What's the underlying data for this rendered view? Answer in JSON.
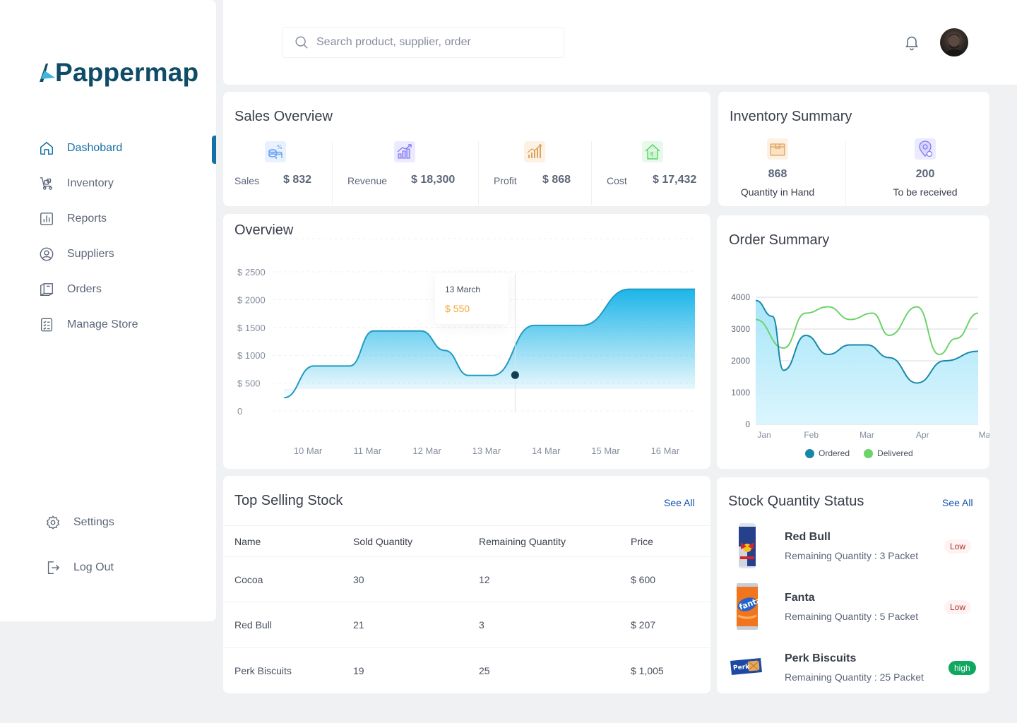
{
  "app": {
    "name": "Pappermap",
    "brand_color": "#0F4C68",
    "accent": "#1570A6"
  },
  "sidebar": {
    "items": [
      {
        "label": "Dashobard",
        "icon": "home-icon",
        "active": true
      },
      {
        "label": "Inventory",
        "icon": "inventory-icon"
      },
      {
        "label": "Reports",
        "icon": "reports-icon"
      },
      {
        "label": "Suppliers",
        "icon": "suppliers-icon"
      },
      {
        "label": "Orders",
        "icon": "orders-icon"
      },
      {
        "label": "Manage Store",
        "icon": "manage-store-icon"
      }
    ],
    "footer": [
      {
        "label": "Settings",
        "icon": "gear-icon"
      },
      {
        "label": "Log Out",
        "icon": "logout-icon"
      }
    ]
  },
  "topbar": {
    "search_placeholder": "Search product, supplier, order"
  },
  "sales_overview": {
    "title": "Sales Overview",
    "stats": [
      {
        "label": "Sales",
        "value": "$ 832",
        "icon": "sales-icon",
        "color": "#6FA4FF"
      },
      {
        "label": "Revenue",
        "value": "$ 18,300",
        "icon": "revenue-icon",
        "color": "#817AF3"
      },
      {
        "label": "Profit",
        "value": "$ 868",
        "icon": "profit-icon",
        "color": "#DBA362"
      },
      {
        "label": "Cost",
        "value": "$ 17,432",
        "icon": "cost-icon",
        "color": "#58D365"
      }
    ]
  },
  "inventory_summary": {
    "title": "Inventory Summary",
    "stats": [
      {
        "value": "868",
        "label": "Quantity in Hand",
        "icon": "box-icon"
      },
      {
        "value": "200",
        "label": "To be received",
        "icon": "location-icon"
      }
    ]
  },
  "overview": {
    "title": "Overview",
    "tooltip": {
      "date": "13 March",
      "value": "$ 550"
    }
  },
  "order_summary": {
    "title": "Order Summary",
    "legend": [
      "Ordered",
      "Delivered"
    ]
  },
  "chart_data": [
    {
      "type": "area",
      "title": "Overview",
      "x": [
        "10 Mar",
        "11 Mar",
        "12 Mar",
        "13 Mar",
        "14 Mar",
        "15 Mar",
        "16 Mar"
      ],
      "y_ticks": [
        "0",
        "$ 500",
        "$ 1000",
        "$ 1500",
        "$ 2000",
        "$ 2500"
      ],
      "ylim": [
        0,
        2500
      ],
      "series": [
        {
          "values": [
            250,
            820,
            820,
            1450,
            1450,
            1100,
            650,
            650,
            1550,
            1550,
            2200,
            2200
          ],
          "x_positions": [
            9.6,
            10.1,
            10.7,
            11.1,
            11.9,
            12.3,
            12.7,
            13.1,
            13.8,
            14.6,
            15.4,
            16.5
          ]
        }
      ],
      "highlight": {
        "x": "13 Mar",
        "value": 650
      },
      "color": "#1F9BC2"
    },
    {
      "type": "line",
      "title": "Order Summary",
      "categories": [
        "Jan",
        "Feb",
        "Mar",
        "Apr",
        "May"
      ],
      "y_ticks": [
        "0",
        "1000",
        "2000",
        "3000",
        "4000"
      ],
      "ylim": [
        0,
        4000
      ],
      "series": [
        {
          "name": "Ordered",
          "color": "#1888AA",
          "x": [
            0,
            0.3,
            0.5,
            0.9,
            1.3,
            1.7,
            2.0,
            2.4,
            2.9,
            3.4,
            4.0
          ],
          "values": [
            3900,
            3400,
            1700,
            2800,
            2200,
            2500,
            2500,
            2100,
            1300,
            2000,
            2300
          ]
        },
        {
          "name": "Delivered",
          "color": "#6CD36A",
          "x": [
            0,
            0.5,
            0.9,
            1.3,
            1.7,
            2.1,
            2.4,
            2.9,
            3.3,
            3.6,
            4.0
          ],
          "values": [
            3300,
            2400,
            3500,
            3700,
            3300,
            3500,
            2800,
            3700,
            2200,
            2700,
            3500
          ]
        }
      ]
    }
  ],
  "top_selling_stock": {
    "title": "Top Selling Stock",
    "see_all": "See All",
    "columns": [
      "Name",
      "Sold Quantity",
      "Remaining Quantity",
      "Price"
    ],
    "rows": [
      [
        "Cocoa",
        "30",
        "12",
        "$ 600"
      ],
      [
        "Red Bull",
        "21",
        "3",
        "$ 207"
      ],
      [
        "Perk Biscuits",
        "19",
        "25",
        "$ 1,005"
      ]
    ]
  },
  "stock_quantity_status": {
    "title": "Stock Quantity Status",
    "see_all": "See All",
    "items": [
      {
        "name": "Red Bull",
        "remaining": "Remaining Quantity : 3 Packet",
        "status": "Low",
        "image": "redbull-can-icon"
      },
      {
        "name": "Fanta",
        "remaining": "Remaining Quantity : 5 Packet",
        "status": "Low",
        "image": "fanta-can-icon"
      },
      {
        "name": "Perk Biscuits",
        "remaining": "Remaining Quantity : 25 Packet",
        "status": "high",
        "image": "perk-biscuit-icon"
      }
    ]
  }
}
